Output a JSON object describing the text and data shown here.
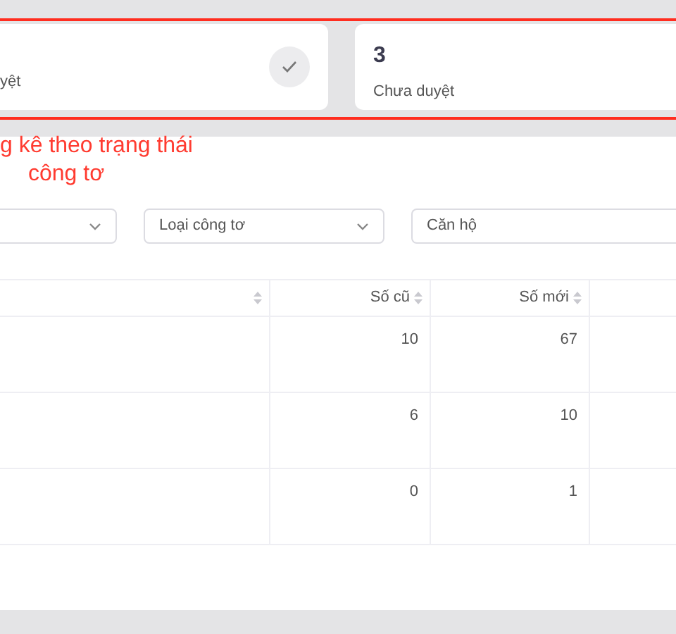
{
  "stat_cards": [
    {
      "label": "yệt",
      "kind": "approved"
    },
    {
      "value": "3",
      "label": "Chưa duyệt",
      "kind": "pending"
    }
  ],
  "annotation": {
    "lines": [
      "g kê theo trạng thái",
      "công tơ"
    ]
  },
  "filters": [
    {
      "kind": "select"
    },
    {
      "kind": "select",
      "placeholder": "Loại công tơ"
    },
    {
      "kind": "input",
      "placeholder": "Căn hộ"
    }
  ],
  "table": {
    "columns": [
      {
        "sortable": true
      },
      {
        "label": "Số cũ",
        "sortable": true
      },
      {
        "label": "Số mới",
        "sortable": true
      }
    ],
    "rows": [
      [
        "10",
        "67"
      ],
      [
        "6",
        "10"
      ],
      [
        "0",
        "1"
      ]
    ]
  }
}
